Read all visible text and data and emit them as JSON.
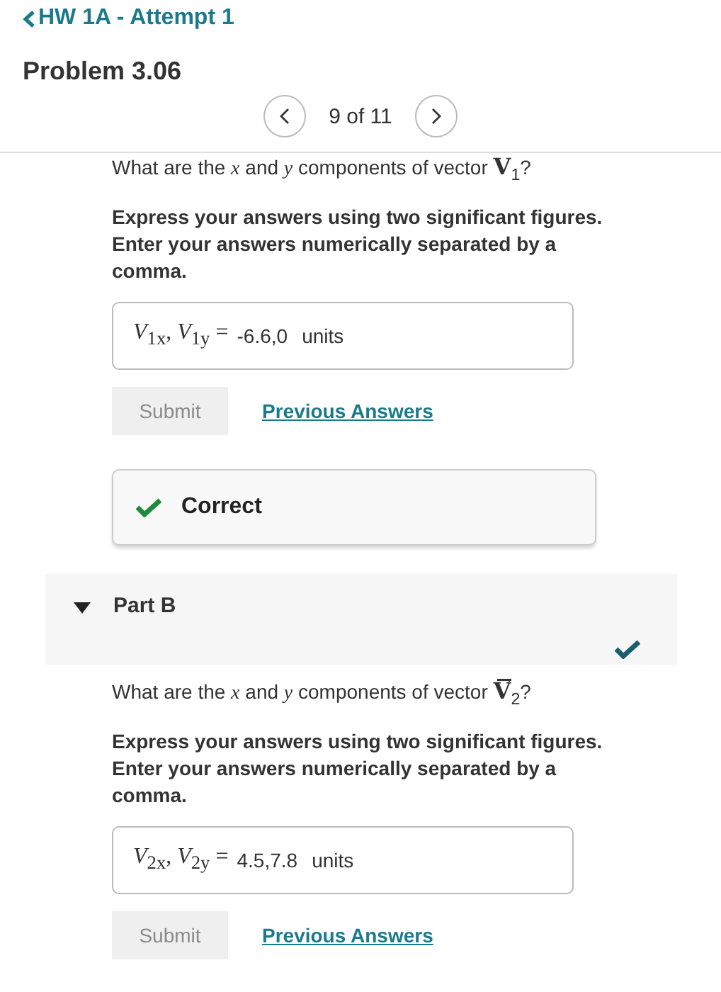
{
  "header": {
    "back_link": "HW 1A - Attempt 1",
    "title": "Problem 3.06"
  },
  "pager": {
    "position": "9 of 11"
  },
  "parts": [
    {
      "question": "What are the *x* and *y* components of vector **V**$_{1}$?",
      "instructions": "Express your answers using two significant figures. Enter your answers numerically separated by a comma.",
      "answer": {
        "label": "*V*$_{1x}$, *V*$_{1y}$ =",
        "value": "-6.6,0",
        "unit": "units"
      },
      "submit": {
        "label": "Submit",
        "disabled": true
      },
      "previous_answers": "Previous Answers",
      "feedback": {
        "kind": "correct",
        "text": "Correct"
      }
    },
    {
      "label": "Part B",
      "expanded": true,
      "completed": true,
      "question": "What are the *x* and *y* components of vector **V**$_{2}$?",
      "vector_arrow": true,
      "instructions": "Express your answers using two significant figures. Enter your answers numerically separated by a comma.",
      "answer": {
        "label": "*V*$_{2x}$, *V*$_{2y}$ =",
        "value": "4.5,7.8",
        "unit": "units"
      },
      "submit": {
        "label": "Submit",
        "disabled": true
      },
      "previous_answers": "Previous Answers"
    }
  ]
}
